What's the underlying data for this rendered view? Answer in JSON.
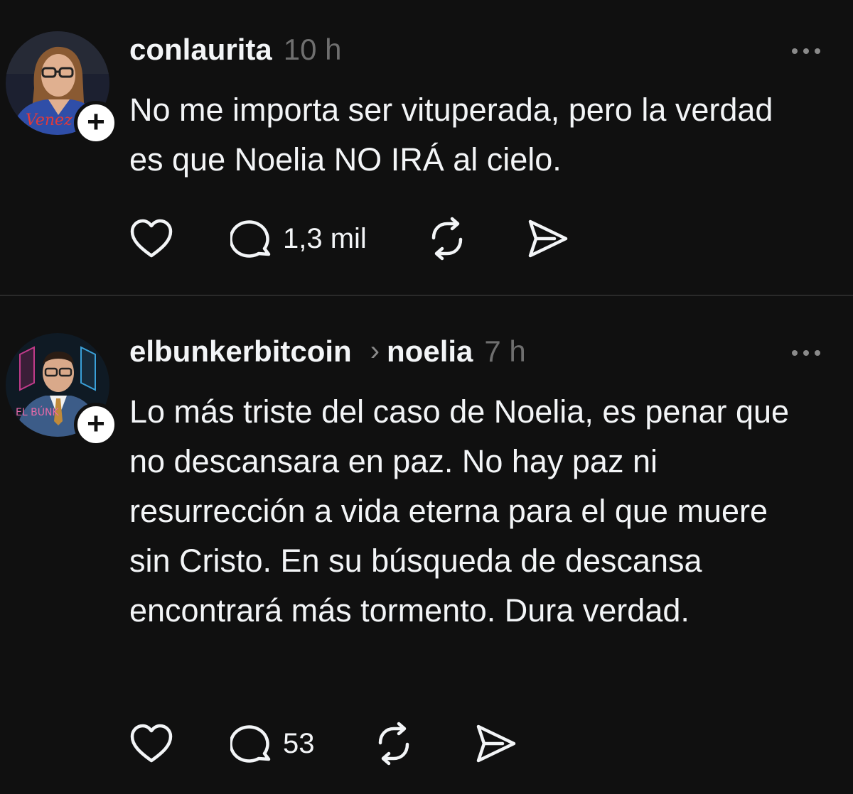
{
  "posts": [
    {
      "username": "conlaurita",
      "time": "10 h",
      "text": "No me importa ser vituperada, pero la verdad es que Noelia NO IRÁ al cielo.",
      "reply_count": "1,3 mil",
      "avatar_text": "Venez",
      "follow_symbol": "+"
    },
    {
      "username": "elbunkerbitcoin",
      "reply_separator": "›",
      "reply_to": "noelia",
      "time": "7 h",
      "text": "Lo más triste del caso de Noelia, es penar que no descansara en paz. No hay paz ni resurrección a vida eterna para el que muere sin Cristo. En su búsqueda de descansa encontrará más tormento. Dura verdad.",
      "reply_count": "53",
      "avatar_text": "EL BÚNK",
      "follow_symbol": "+"
    }
  ],
  "icons": [
    "heart-icon",
    "comment-icon",
    "repost-icon",
    "share-icon",
    "more-icon",
    "plus-icon"
  ],
  "colors": {
    "background": "#101010",
    "text": "#f3f5f7",
    "secondary": "#6f6f6f",
    "divider": "#2a2a2a"
  }
}
